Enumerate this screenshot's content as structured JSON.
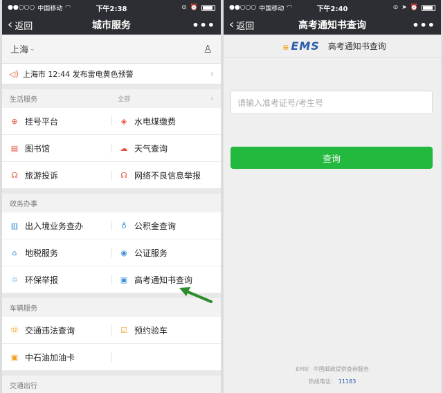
{
  "left": {
    "status": {
      "carrier": "中国移动",
      "time": "下午2:38"
    },
    "nav": {
      "back": "返回",
      "title": "城市服务",
      "more": "•••"
    },
    "city": "上海",
    "alert": "上海市 12:44 发布雷电黄色预警",
    "sections": [
      {
        "title": "生活服务",
        "all": "全部",
        "items": [
          {
            "label": "挂号平台",
            "icon": "hospital-icon",
            "glyph": "⊕",
            "color": "#e6533c"
          },
          {
            "label": "水电煤缴费",
            "icon": "water-drop-icon",
            "glyph": "◈",
            "color": "#e6533c"
          },
          {
            "label": "图书馆",
            "icon": "library-icon",
            "glyph": "▤",
            "color": "#e6533c"
          },
          {
            "label": "天气查询",
            "icon": "weather-icon",
            "glyph": "☁",
            "color": "#e6533c"
          },
          {
            "label": "旅游投诉",
            "icon": "headset-icon",
            "glyph": "☊",
            "color": "#e6533c"
          },
          {
            "label": "网络不良信息举报",
            "icon": "report-icon",
            "glyph": "☊",
            "color": "#e6533c"
          }
        ]
      },
      {
        "title": "政务办事",
        "all": "",
        "items": [
          {
            "label": "出入境业务查办",
            "icon": "passport-icon",
            "glyph": "▥",
            "color": "#3a8ed8"
          },
          {
            "label": "公积金查询",
            "icon": "piggy-bank-icon",
            "glyph": "♁",
            "color": "#3a8ed8"
          },
          {
            "label": "地税服务",
            "icon": "home-icon",
            "glyph": "⌂",
            "color": "#3a8ed8"
          },
          {
            "label": "公证服务",
            "icon": "seal-icon",
            "glyph": "◉",
            "color": "#3a8ed8"
          },
          {
            "label": "环保举报",
            "icon": "recycle-icon",
            "glyph": "♲",
            "color": "#3a8ed8"
          },
          {
            "label": "高考通知书查询",
            "icon": "notice-icon",
            "glyph": "▣",
            "color": "#3a8ed8"
          }
        ]
      },
      {
        "title": "车辆服务",
        "all": "",
        "items": [
          {
            "label": "交通违法查询",
            "icon": "calendar-12-icon",
            "glyph": "⑫",
            "color": "#f0a020"
          },
          {
            "label": "预约验车",
            "icon": "check-box-icon",
            "glyph": "☑",
            "color": "#f0a020"
          },
          {
            "label": "中石油加油卡",
            "icon": "fuel-card-icon",
            "glyph": "▣",
            "color": "#f0a020"
          },
          {
            "label": "",
            "icon": "",
            "glyph": "",
            "color": "#f0a020"
          }
        ]
      },
      {
        "title": "交通出行",
        "all": "",
        "items": []
      }
    ]
  },
  "right": {
    "status": {
      "carrier": "中国移动",
      "time": "下午2:40"
    },
    "nav": {
      "back": "返回",
      "title": "高考通知书查询",
      "more": "•••"
    },
    "ems": {
      "logo": "EMS",
      "title": "高考通知书查询"
    },
    "input_placeholder": "请输入准考证号/考生号",
    "button": "查询",
    "footer": {
      "brand": "EMS",
      "line1": "中国邮政提供查询服务",
      "line2": "热线电话:",
      "phone": "11183"
    }
  }
}
